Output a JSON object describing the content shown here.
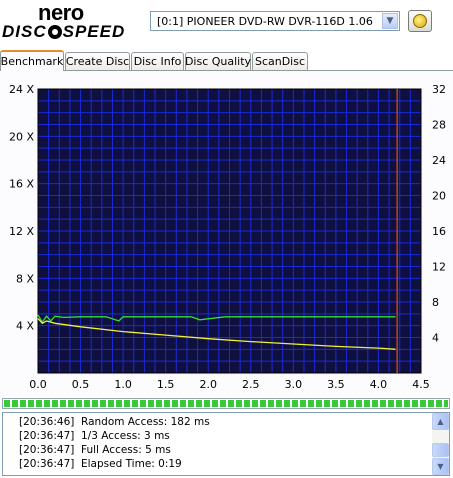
{
  "header": {
    "logo_top": "nero",
    "logo_bottom_left": "DISC",
    "logo_bottom_right": "SPEED",
    "drive_selected": "[0:1]  PIONEER DVD-RW  DVR-116D 1.06"
  },
  "tabs": [
    {
      "label": "Benchmark",
      "active": true
    },
    {
      "label": "Create Disc",
      "active": false
    },
    {
      "label": "Disc Info",
      "active": false
    },
    {
      "label": "Disc Quality",
      "active": false
    },
    {
      "label": "ScanDisc",
      "active": false
    }
  ],
  "chart_data": {
    "type": "line",
    "xlabel": "",
    "ylabel": "",
    "xlim": [
      0,
      4.5
    ],
    "ylim_left": [
      0,
      24
    ],
    "ylim_right": [
      0,
      32
    ],
    "x_ticks": [
      "0.0",
      "0.5",
      "1.0",
      "1.5",
      "2.0",
      "2.5",
      "3.0",
      "3.5",
      "4.0",
      "4.5"
    ],
    "y_left_ticks": [
      "4 X",
      "8 X",
      "12 X",
      "16 X",
      "20 X",
      "24 X"
    ],
    "y_right_ticks": [
      "4",
      "8",
      "12",
      "16",
      "20",
      "24",
      "28",
      "32"
    ],
    "grid": true,
    "background_color": "#101040",
    "grid_color": "#1a2ad8",
    "end_marker_x": 4.22,
    "series": [
      {
        "color": "#31e231",
        "axis": "left",
        "x": [
          0.0,
          0.05,
          0.1,
          0.15,
          0.2,
          0.3,
          0.5,
          0.8,
          0.95,
          1.0,
          1.2,
          1.5,
          1.8,
          1.9,
          2.2,
          2.5,
          2.8,
          3.2,
          3.5,
          3.8,
          4.0,
          4.2
        ],
        "y": [
          4.9,
          4.3,
          4.8,
          4.4,
          4.8,
          4.7,
          4.75,
          4.75,
          4.4,
          4.75,
          4.75,
          4.75,
          4.75,
          4.5,
          4.75,
          4.75,
          4.75,
          4.75,
          4.75,
          4.75,
          4.75,
          4.75
        ]
      },
      {
        "color": "#f0f03c",
        "axis": "left",
        "x": [
          0.0,
          0.05,
          0.1,
          0.2,
          0.5,
          1.0,
          1.5,
          2.0,
          2.5,
          3.0,
          3.5,
          4.0,
          4.2
        ],
        "y": [
          4.6,
          4.2,
          4.4,
          4.2,
          3.9,
          3.5,
          3.2,
          2.9,
          2.65,
          2.45,
          2.25,
          2.1,
          2.0
        ]
      }
    ]
  },
  "progress": {
    "percent": 100
  },
  "log": [
    {
      "time": "[20:36:46]",
      "msg": "Random Access: 182 ms"
    },
    {
      "time": "[20:36:47]",
      "msg": "1/3 Access: 3 ms"
    },
    {
      "time": "[20:36:47]",
      "msg": "Full Access: 5 ms"
    },
    {
      "time": "[20:36:47]",
      "msg": "Elapsed Time:  0:19"
    }
  ]
}
